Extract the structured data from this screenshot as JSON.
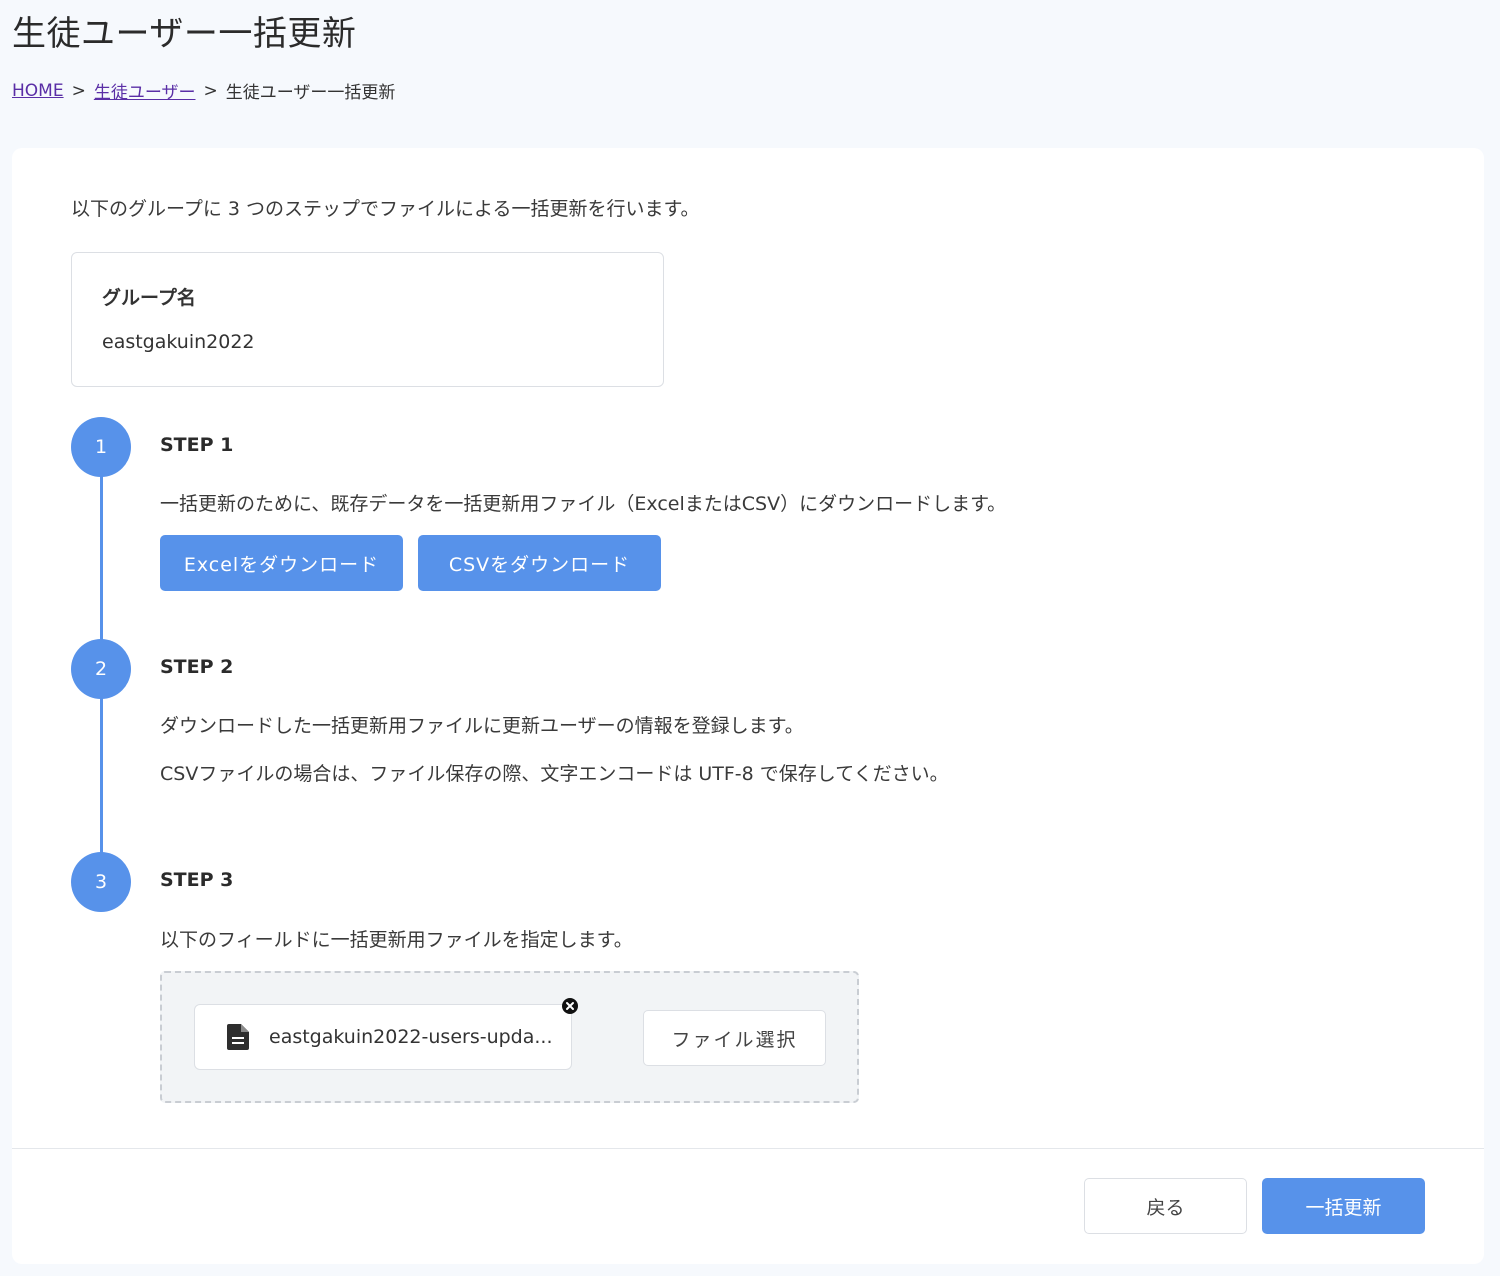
{
  "page": {
    "title": "生徒ユーザー一括更新"
  },
  "breadcrumb": {
    "home": "HOME",
    "separator": ">",
    "parent": "生徒ユーザー",
    "current": "生徒ユーザー一括更新"
  },
  "intro": "以下のグループに 3 つのステップでファイルによる一括更新を行います。",
  "group": {
    "label": "グループ名",
    "value": "eastgakuin2022"
  },
  "steps": [
    {
      "number": "1",
      "title": "STEP 1",
      "texts": [
        "一括更新のために、既存データを一括更新用ファイル（ExcelまたはCSV）にダウンロードします。"
      ],
      "buttons": [
        "Excelをダウンロード",
        "CSVをダウンロード"
      ]
    },
    {
      "number": "2",
      "title": "STEP 2",
      "texts": [
        "ダウンロードした一括更新用ファイルに更新ユーザーの情報を登録します。",
        "CSVファイルの場合は、ファイル保存の際、文字エンコードは UTF-8 で保存してください。"
      ]
    },
    {
      "number": "3",
      "title": "STEP 3",
      "texts": [
        "以下のフィールドに一括更新用ファイルを指定します。"
      ]
    }
  ],
  "upload": {
    "file_name": "eastgakuin2022-users-upda...",
    "select_label": "ファイル選択"
  },
  "footer": {
    "back_label": "戻る",
    "update_label": "一括更新"
  },
  "colors": {
    "accent": "#5792ea",
    "background": "#f6f9fd",
    "link": "#5a2ea6"
  }
}
